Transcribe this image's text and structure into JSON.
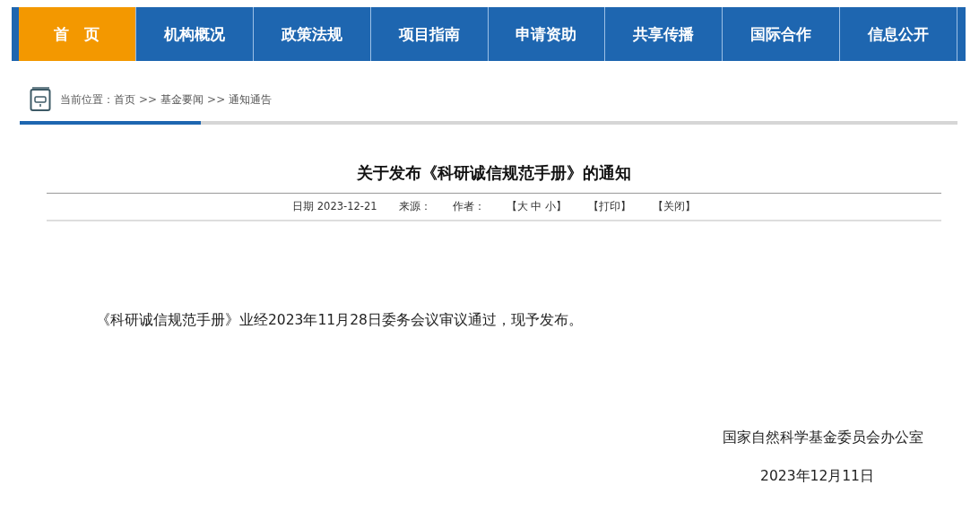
{
  "nav": [
    {
      "label": "首　页",
      "selected": true
    },
    {
      "label": "机构概况",
      "selected": false
    },
    {
      "label": "政策法规",
      "selected": false
    },
    {
      "label": "项目指南",
      "selected": false
    },
    {
      "label": "申请资助",
      "selected": false
    },
    {
      "label": "共享传播",
      "selected": false
    },
    {
      "label": "国际合作",
      "selected": false
    },
    {
      "label": "信息公开",
      "selected": false
    }
  ],
  "breadcrumb": {
    "prefix": "当前位置：",
    "items": [
      "首页",
      "基金要闻",
      "通知通告"
    ],
    "separator": ">>"
  },
  "article": {
    "title": "关于发布《科研诚信规范手册》的通知",
    "meta": [
      "日期 2023-12-21",
      "来源：",
      "作者：",
      "【大 中 小】",
      "【打印】",
      "【关闭】"
    ],
    "body": "《科研诚信规范手册》业经2023年11月28日委务会议审议通过，现予发布。",
    "signature": "国家自然科学基金委员会办公室",
    "date": "2023年12月11日"
  }
}
